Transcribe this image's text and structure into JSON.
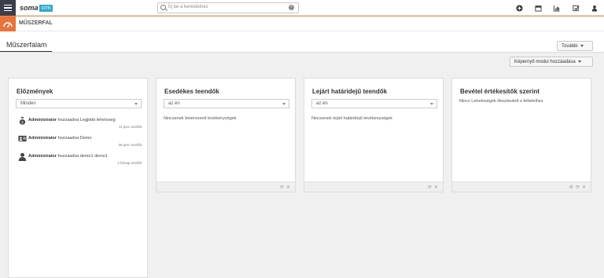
{
  "header": {
    "logo_primary": "soma",
    "logo_secondary": "crm",
    "search_placeholder": "Írj be a kereséshez"
  },
  "module": {
    "title": "MŰSZERFAL"
  },
  "page": {
    "title": "Műszerfalam",
    "more_button": "További",
    "add_module_button": "Képernyő modul hozzáadása"
  },
  "cards": {
    "history": {
      "title": "Előzmények",
      "filter": "Minden",
      "items": [
        {
          "user": "Administrator",
          "action": "hozzaadva Legjobb lehetoseg",
          "time": "11 perc ezelőtt",
          "icon": "money-bag-icon"
        },
        {
          "user": "Administrator",
          "action": "hozzaadva Demo",
          "time": "28 perc ezelőtt",
          "icon": "contact-card-icon"
        },
        {
          "user": "Administrator",
          "action": "hozzaadva demo1 demo1",
          "time": "2 hónap ezelőtt",
          "icon": "person-icon"
        }
      ]
    },
    "due_tasks": {
      "title": "Esedékes teendők",
      "filter": "az én",
      "empty": "Nincsenek betervezett tevékenységek"
    },
    "overdue_tasks": {
      "title": "Lejárt határidejű teendők",
      "filter": "az én",
      "empty": "Nincsenek lejárt határidejű tevékenységek"
    },
    "revenue": {
      "title": "Bevétel értékesítők szerint",
      "empty": "Nincs Lehetoségek illeszkedett a feltetelhez"
    }
  },
  "colors": {
    "accent_orange": "#e8743b",
    "logo_blue": "#2ea8c9",
    "dark": "#3a3f4a"
  }
}
